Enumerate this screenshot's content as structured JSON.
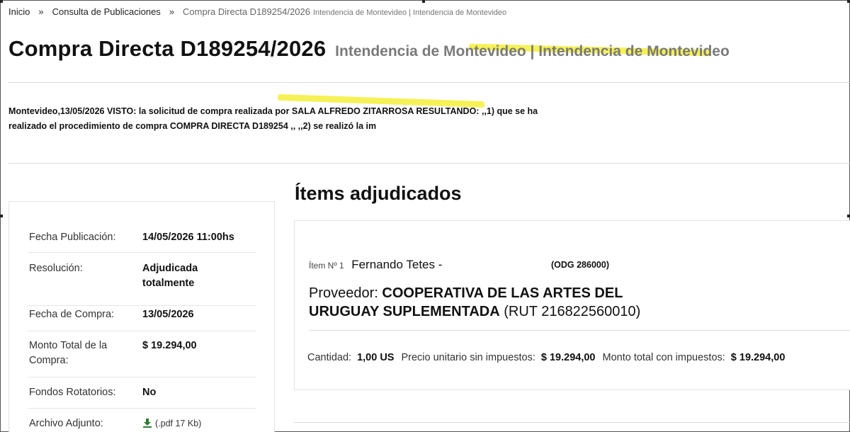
{
  "breadcrumb": {
    "home": "Inicio",
    "separator": "»",
    "consulta": "Consulta de Publicaciones",
    "current": "Compra Directa D189254/2026",
    "current_org": "Intendencia de Montevideo | Intendencia de Montevideo"
  },
  "title": {
    "main": "Compra Directa D189254/2026",
    "org": "Intendencia de Montevideo | Intendencia de Montevideo"
  },
  "description": {
    "line1": "Montevideo,13/05/2026 VISTO: la solicitud de compra realizada por SALA ALFREDO ZITARROSA RESULTANDO: ,,1) que se ha",
    "line2": "realizado el procedimiento de compra COMPRA DIRECTA D189254 ,, ,,2) se realizó la im"
  },
  "info": {
    "fecha_publicacion": {
      "label": "Fecha Publicación:",
      "value": "14/05/2026 11:00hs"
    },
    "resolucion": {
      "label": "Resolución:",
      "value_line1": "Adjudicada",
      "value_line2": "totalmente"
    },
    "fecha_compra": {
      "label": "Fecha de Compra:",
      "value": "13/05/2026"
    },
    "monto_total": {
      "label_line1": "Monto Total de la",
      "label_line2": "Compra:",
      "value": "$ 19.294,00"
    },
    "fondos_rotatorios": {
      "label": "Fondos Rotatorios:",
      "value": "No"
    },
    "archivo_adjunto": {
      "label": "Archivo Adjunto:",
      "value": "(.pdf 17 Kb)"
    }
  },
  "items_section": {
    "title": "Ítems adjudicados",
    "item": {
      "number": "Ítem Nº 1",
      "name": "Fernando Tetes -",
      "odg": "(ODG 286000)",
      "provider_label": "Proveedor:",
      "provider_name_line1": "COOPERATIVA DE LAS ARTES DEL",
      "provider_name_line2": "URUGUAY SUPLEMENTADA",
      "provider_rut": "(RUT 216822560010)",
      "cantidad_label": "Cantidad:",
      "cantidad_value": "1,00 US",
      "precio_label": "Precio unitario sin impuestos:",
      "precio_value": "$ 19.294,00",
      "monto_label": "Monto total con impuestos:",
      "monto_value": "$ 19.294,00"
    }
  },
  "colors": {
    "highlight": "#f4ef3a",
    "download_icon": "#2e7d32"
  },
  "icons": {
    "download": "download-icon"
  }
}
